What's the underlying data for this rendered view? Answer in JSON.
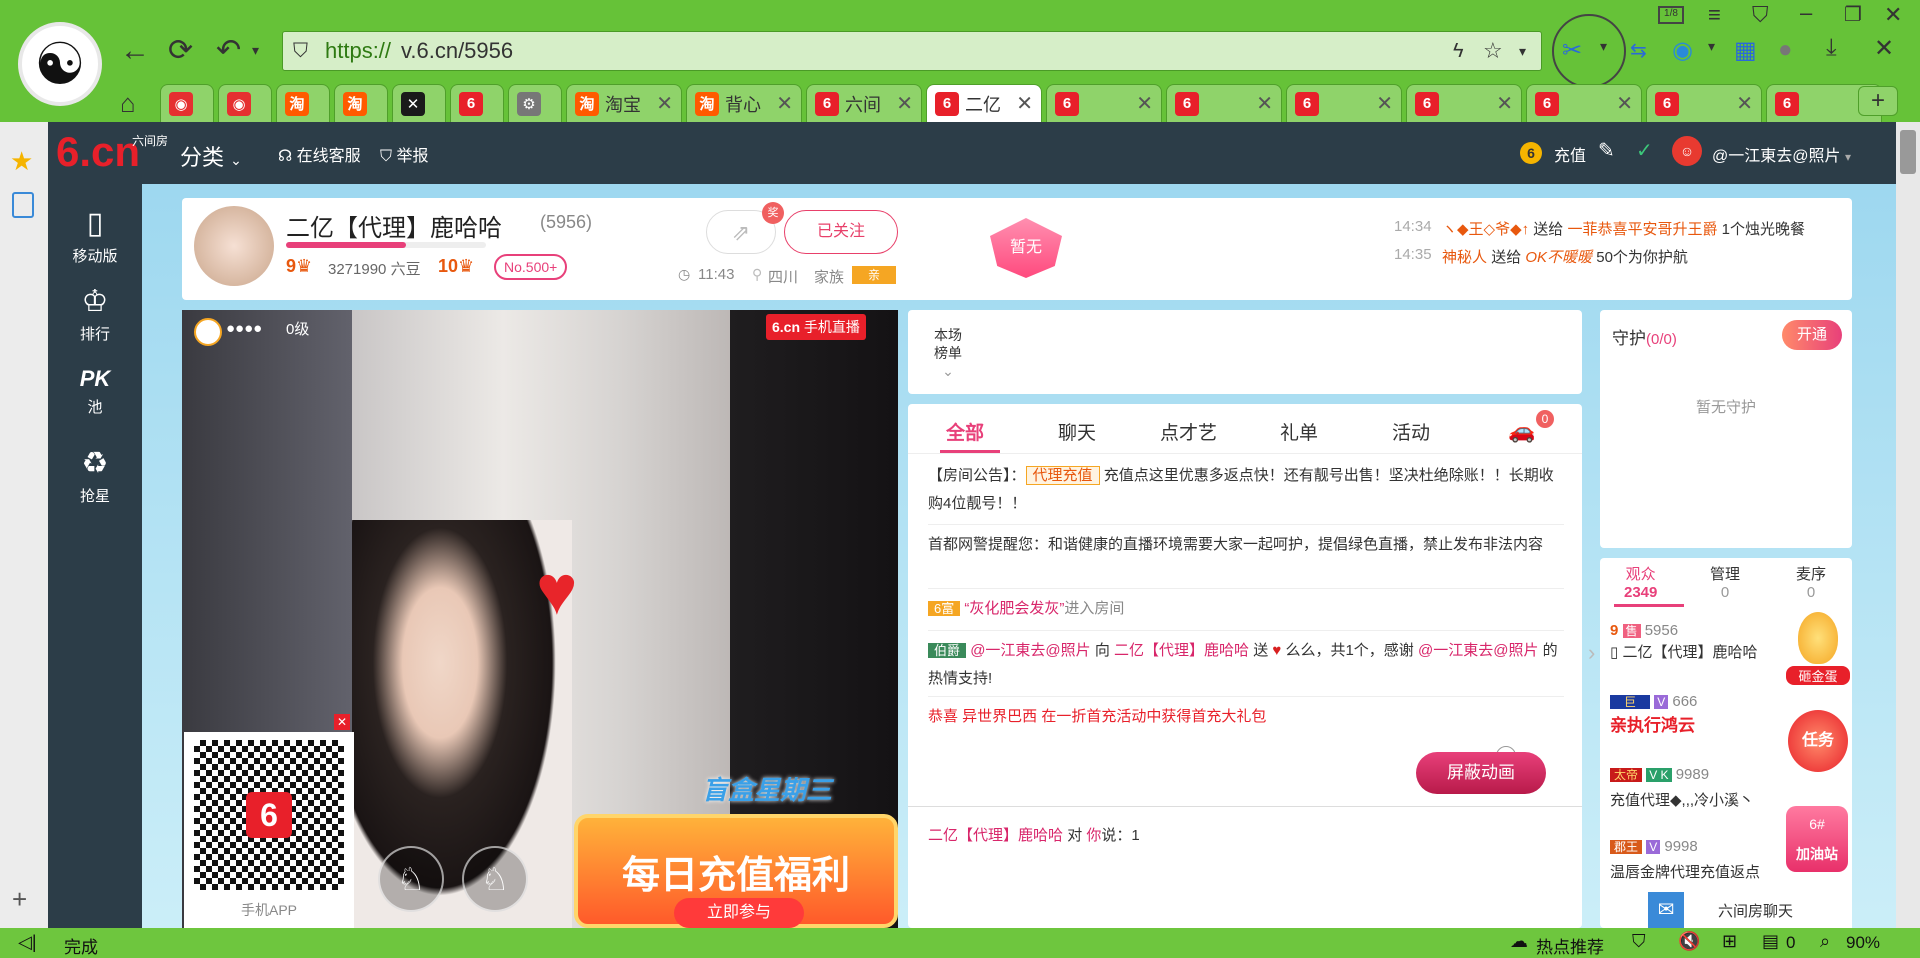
{
  "browser": {
    "url_prefix": "https://",
    "url_rest": "v.6.cn/5956",
    "tabs": [
      {
        "label": "",
        "color": "#e53030",
        "glyph": "◉"
      },
      {
        "label": "",
        "color": "#e53030",
        "glyph": "◉"
      },
      {
        "label": "",
        "color": "#ff5a00",
        "glyph": "淘"
      },
      {
        "label": "",
        "color": "#ff5a00",
        "glyph": "淘"
      },
      {
        "label": "",
        "color": "#1a1a1a",
        "glyph": "✕"
      },
      {
        "label": "",
        "color": "#e8202a",
        "glyph": "6"
      },
      {
        "label": "",
        "color": "#777777",
        "glyph": "⚙"
      },
      {
        "label": "淘宝",
        "color": "#ff5a00",
        "glyph": "淘"
      },
      {
        "label": "背心",
        "color": "#ff5a00",
        "glyph": "淘"
      },
      {
        "label": "六间",
        "color": "#e8202a",
        "glyph": "6"
      },
      {
        "label": "二亿",
        "color": "#e8202a",
        "glyph": "6"
      },
      {
        "label": "",
        "color": "#e8202a",
        "glyph": "6"
      },
      {
        "label": "",
        "color": "#e8202a",
        "glyph": "6"
      },
      {
        "label": "",
        "color": "#e8202a",
        "glyph": "6"
      },
      {
        "label": "",
        "color": "#e8202a",
        "glyph": "6"
      },
      {
        "label": "",
        "color": "#e8202a",
        "glyph": "6"
      },
      {
        "label": "",
        "color": "#e8202a",
        "glyph": "6"
      },
      {
        "label": "",
        "color": "#e8202a",
        "glyph": "6"
      }
    ],
    "status_left": "完成",
    "status_hot": "热点推荐",
    "status_count": "0",
    "status_zoom": "90%"
  },
  "site": {
    "logo_small": "六间房",
    "logo_big": "6.cn",
    "category": "分类",
    "online_service": "在线客服",
    "report": "举报",
    "recharge": "充值",
    "username": "@一江東去@照片",
    "nav": [
      {
        "label": "移动版",
        "icon": "▯"
      },
      {
        "label": "排行",
        "icon": "♔"
      },
      {
        "label": "池",
        "icon": "PK"
      },
      {
        "label": "抢星",
        "icon": "♻"
      }
    ]
  },
  "room": {
    "title": "二亿【代理】鹿哈哈",
    "room_id": "(5956)",
    "level_a": "9",
    "coins": "3271990 六豆",
    "level_b": "10",
    "rank": "No.500+",
    "follow": "已关注",
    "time": "11:43",
    "location": "四川",
    "family": "家族",
    "family_badge": "亲",
    "empty_badge": "暂无",
    "feed": [
      {
        "time": "14:34",
        "text_a": "ヽ◆王◇爷◆↑",
        "action": "送给",
        "target": "一菲恭喜平安哥升王爵",
        "gift": "1个烛光晚餐"
      },
      {
        "time": "14:35",
        "text_a": "神秘人",
        "action": "送给",
        "target": "OK不暖暖",
        "gift": "50个为你护航"
      }
    ]
  },
  "video": {
    "level": "0级",
    "brand": "6.cn",
    "brand_sub": "手机直播",
    "qr_caption": "手机APP",
    "banner": "每日充值福利",
    "banner_sub": "立即参与",
    "box_label": "盲盒星期三"
  },
  "ranking": {
    "label_a": "本场",
    "label_b": "榜单"
  },
  "chat": {
    "tabs": [
      "全部",
      "聊天",
      "点才艺",
      "礼单",
      "活动"
    ],
    "car_badge": "0",
    "notice_head": "【房间公告】：",
    "notice_tag": "代理充值",
    "notice_text": "充值点这里优惠多返点快！还有靓号出售！坚决杜绝除账！！长期收购4位靓号！！",
    "police": "首都网警提醒您：和谐健康的直播环境需要大家一起呵护，提倡绿色直播，禁止发布非法内容",
    "enter_badge": "6富",
    "enter_name": "“灰化肥会发灰”",
    "enter_text": "进入房间",
    "gift_badge": "伯爵",
    "gift_from": "@一江東去@照片",
    "gift_to_word": "向",
    "gift_to": "二亿【代理】鹿哈哈",
    "gift_send": "送",
    "gift_text": "么么，共1个，感谢",
    "gift_thanks_name": "@一江東去@照片",
    "gift_tail": "的热情支持!",
    "congrats": "恭喜 异世界巴西 在一折首充活动中获得首充大礼包",
    "block_anim": "屏蔽动画",
    "said_name": "二亿【代理】鹿哈哈",
    "said_mid": "对",
    "said_you": "你",
    "said_text": "说：1"
  },
  "guard": {
    "title": "守护",
    "count": "(0/0)",
    "open": "开通",
    "empty": "暂无守护"
  },
  "audience": {
    "tabs": [
      {
        "label": "观众",
        "count": "2349"
      },
      {
        "label": "管理",
        "count": "0"
      },
      {
        "label": "麦序",
        "count": "0"
      }
    ],
    "users": [
      {
        "badge": "9",
        "tag": "售",
        "id": "5956",
        "name": "二亿【代理】鹿哈哈"
      },
      {
        "badge": "巨",
        "tag": "V",
        "id": "666",
        "name": "亲执行鸿云"
      },
      {
        "badge": "太帝",
        "tag": "V K",
        "id": "9989",
        "name": "充值代理◆,,,冷小溪丶"
      },
      {
        "badge": "郡王",
        "tag": "V",
        "id": "9998",
        "name": "温唇金牌代理充值返点"
      }
    ],
    "egg": "砸金蛋",
    "task": "任务",
    "boost": "加油站",
    "boost_tag": "6#",
    "room_chat": "六间房聊天"
  }
}
